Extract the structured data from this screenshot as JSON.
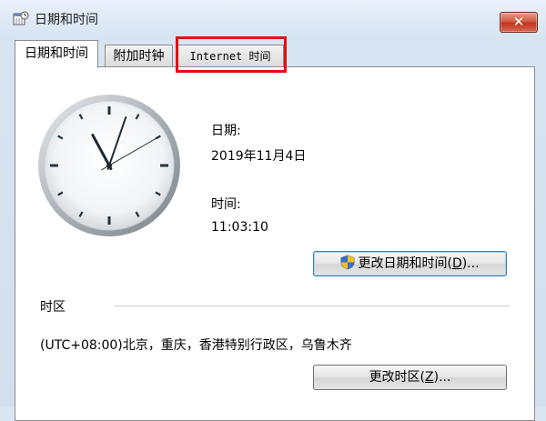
{
  "window": {
    "title": "日期和时间",
    "close_label": "✕"
  },
  "tabs": [
    {
      "label": "日期和时间",
      "active": true
    },
    {
      "label": "附加时钟",
      "active": false
    },
    {
      "label": "Internet 时间",
      "active": false
    }
  ],
  "clock": {
    "hour": 11,
    "minute": 3,
    "second": 10
  },
  "date": {
    "label": "日期:",
    "value": "2019年11月4日"
  },
  "time": {
    "label": "时间:",
    "value": "11:03:10"
  },
  "change_datetime_button": {
    "prefix": "更改日期和时间(",
    "key": "D",
    "suffix": ")..."
  },
  "timezone": {
    "label": "时区",
    "value": "(UTC+08:00)北京，重庆，香港特别行政区，乌鲁木齐"
  },
  "change_timezone_button": {
    "prefix": "更改时区(",
    "key": "Z",
    "suffix": ")..."
  },
  "colors": {
    "highlight": "#e01010",
    "close": "#c3331e"
  }
}
